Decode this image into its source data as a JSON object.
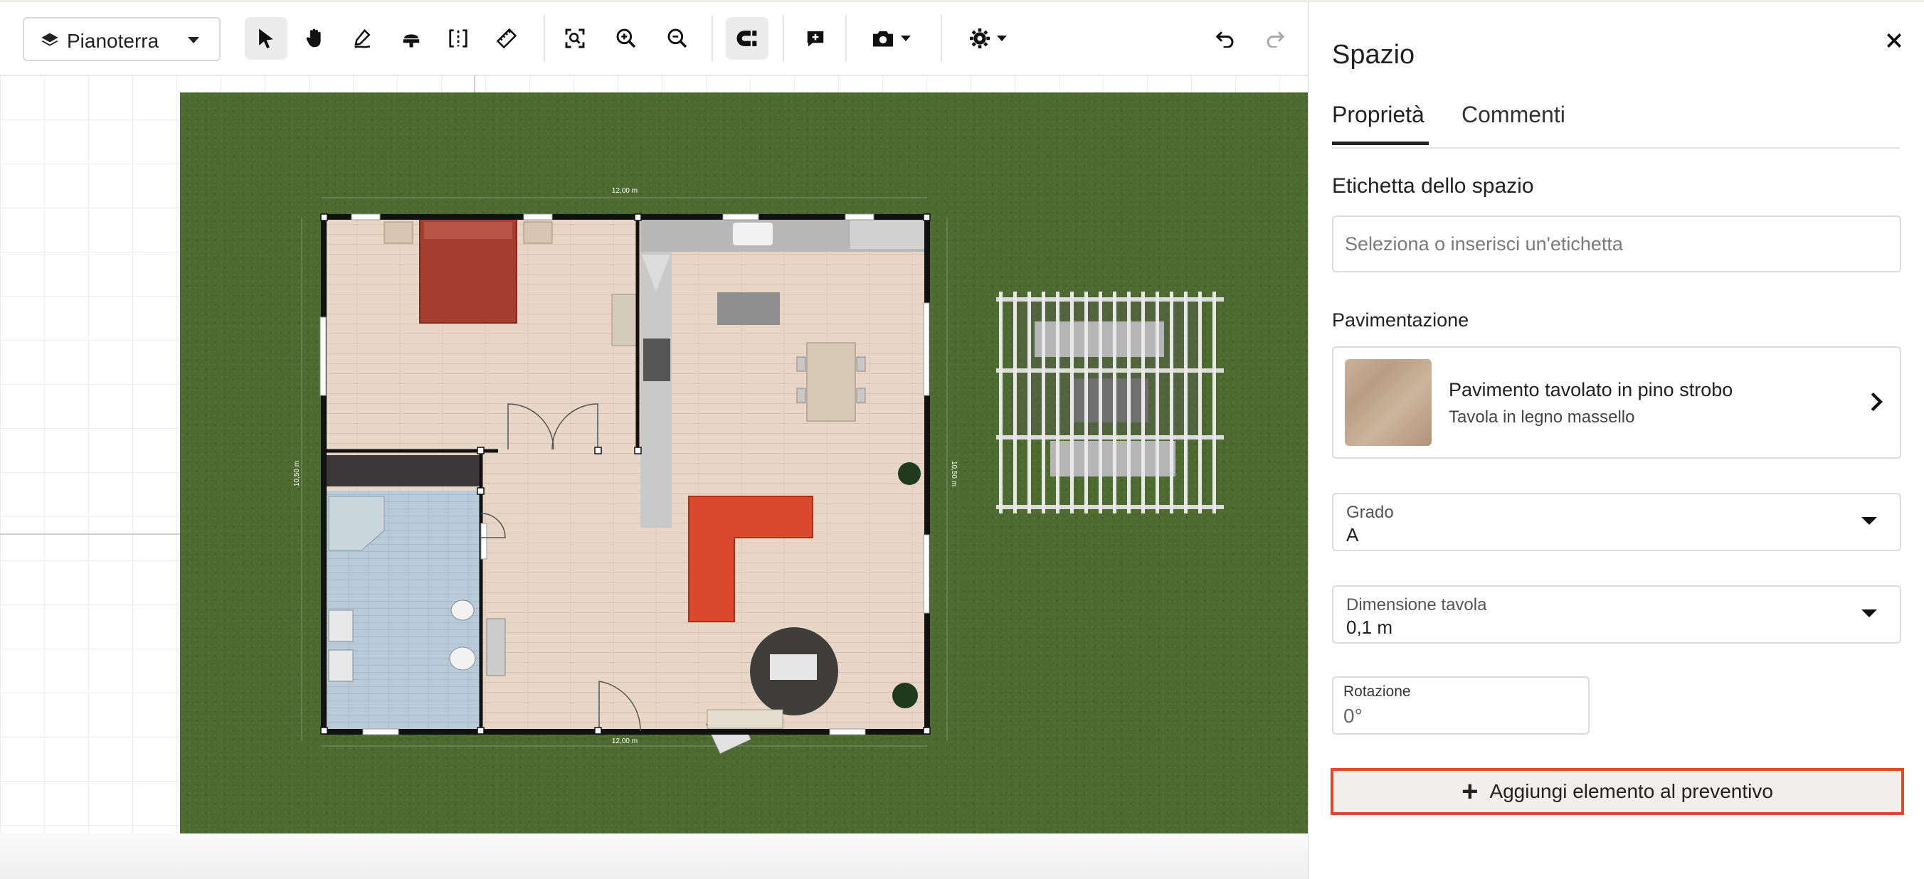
{
  "toolbar": {
    "level_label": "Pianoterra",
    "icons": [
      "layers-icon",
      "chevron-down-icon",
      "select-arrow-icon",
      "hand-pan-icon",
      "draw-wall-icon",
      "paint-bucket-icon",
      "split-icon",
      "measure-ruler-icon",
      "fit-view-icon",
      "zoom-in-icon",
      "zoom-out-icon",
      "magnet-snap-icon",
      "add-comment-icon",
      "camera-icon",
      "settings-gear-icon",
      "undo-icon",
      "redo-icon"
    ]
  },
  "plan": {
    "dim_top": "12,00 m",
    "dim_bottom": "12,00 m",
    "dim_left": "10,50 m",
    "dim_right": "10,50 m"
  },
  "panel": {
    "title": "Spazio",
    "tabs": [
      {
        "label": "Proprietà",
        "active": true
      },
      {
        "label": "Commenti",
        "active": false
      }
    ],
    "space_label_heading": "Etichetta dello spazio",
    "space_label_placeholder": "Seleziona o inserisci un'etichetta",
    "flooring_heading": "Pavimentazione",
    "flooring_name": "Pavimento tavolato in pino strobo",
    "flooring_sub": "Tavola in legno massello",
    "grade_label": "Grado",
    "grade_value": "A",
    "board_label": "Dimensione tavola",
    "board_value": "0,1 m",
    "rotation_label": "Rotazione",
    "rotation_value": "0°",
    "add_button_label": "Aggiungi elemento al preventivo"
  },
  "colors": {
    "grass": "#4d6a30",
    "wood_floor": "#e6d4c2",
    "tile_floor": "#b6cad7",
    "sofa": "#d9482c",
    "bed": "#a63d31",
    "highlight_border": "#e0492a"
  }
}
